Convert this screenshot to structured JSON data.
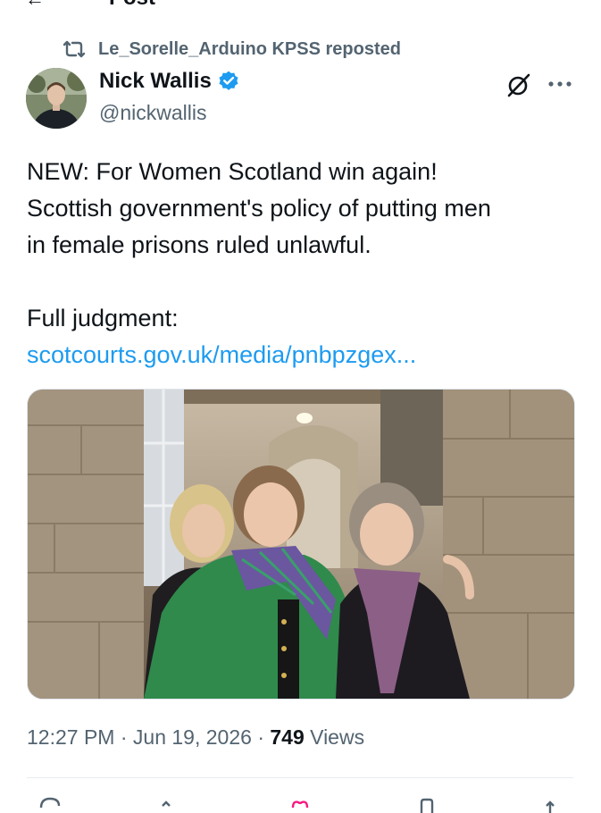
{
  "header": {
    "title": "Post",
    "back_glyph": "←"
  },
  "repost": {
    "text": "Le_Sorelle_Arduino KPSS reposted",
    "icon": "repost-icon"
  },
  "author": {
    "name": "Nick Wallis",
    "handle": "@nickwallis",
    "verified": true,
    "verified_color": "#1d9bf0"
  },
  "tweet": {
    "line1": "NEW: For Women Scotland win again!",
    "line2": "Scottish government's policy of putting men",
    "line3": "in female prisons ruled unlawful.",
    "line4": "Full judgment:",
    "link": "scotcourts.gov.uk/media/pnbpzgex..."
  },
  "meta": {
    "time": "12:27 PM",
    "sep1": "·",
    "date": "Jun 19, 2026",
    "sep2": "·",
    "views_count": "749",
    "views_label": "Views"
  },
  "colors": {
    "accent": "#1d9bf0",
    "muted": "#536471",
    "text": "#0f1419"
  },
  "icons": [
    "repost-icon",
    "verified-badge-icon",
    "grok-icon",
    "more-icon",
    "reply-icon",
    "retweet-icon",
    "like-icon",
    "bookmark-icon",
    "share-icon"
  ]
}
